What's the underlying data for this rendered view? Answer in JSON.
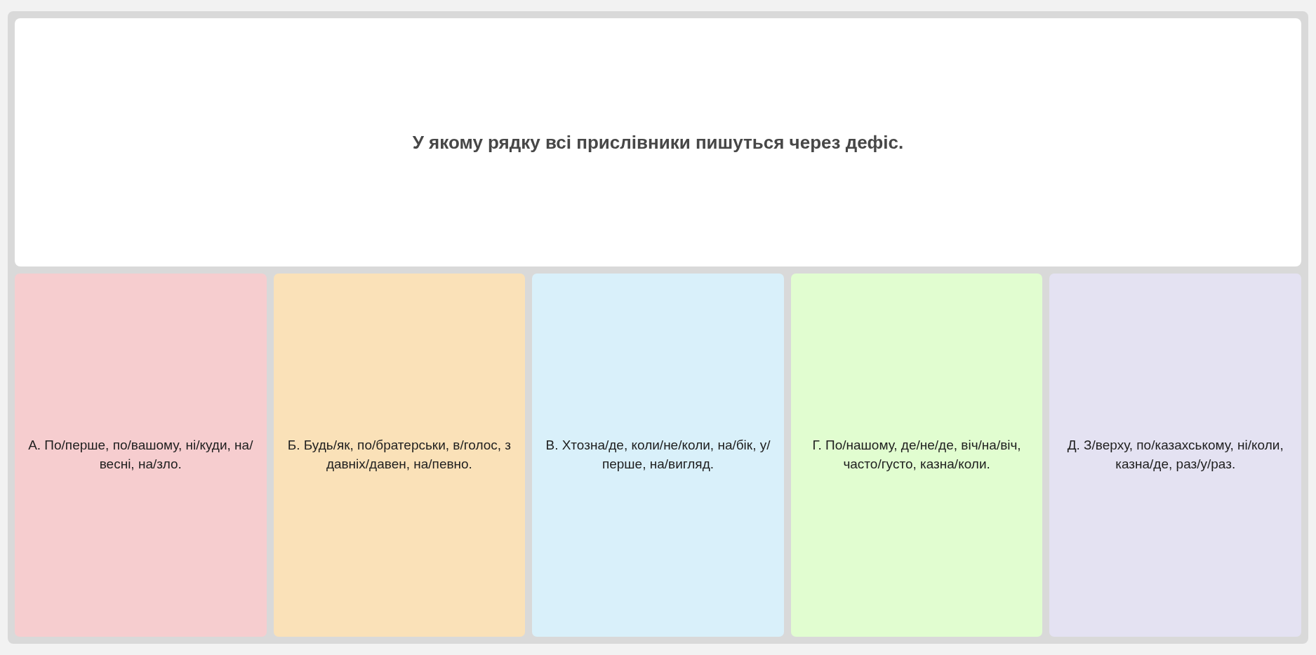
{
  "question": "У якому рядку всі прислівники пишуться через дефіс.",
  "answers": [
    {
      "text": "А. По/перше, по/вашому, ні/куди, на/весні, на/зло.",
      "color": "#f6cdcf"
    },
    {
      "text": "Б. Будь/як, по/братерськи, в/голос, з давніх/давен, на/певно.",
      "color": "#fae1b8"
    },
    {
      "text": "В. Хтозна/де, коли/не/коли, на/бік, у/перше, на/вигляд.",
      "color": "#d9f0fa"
    },
    {
      "text": "Г. По/нашому, де/не/де, віч/на/віч, часто/густо, казна/коли.",
      "color": "#e1fdd0"
    },
    {
      "text": "Д. З/верху, по/казахському, ні/коли, казна/де, раз/у/раз.",
      "color": "#e4e2f2"
    }
  ]
}
